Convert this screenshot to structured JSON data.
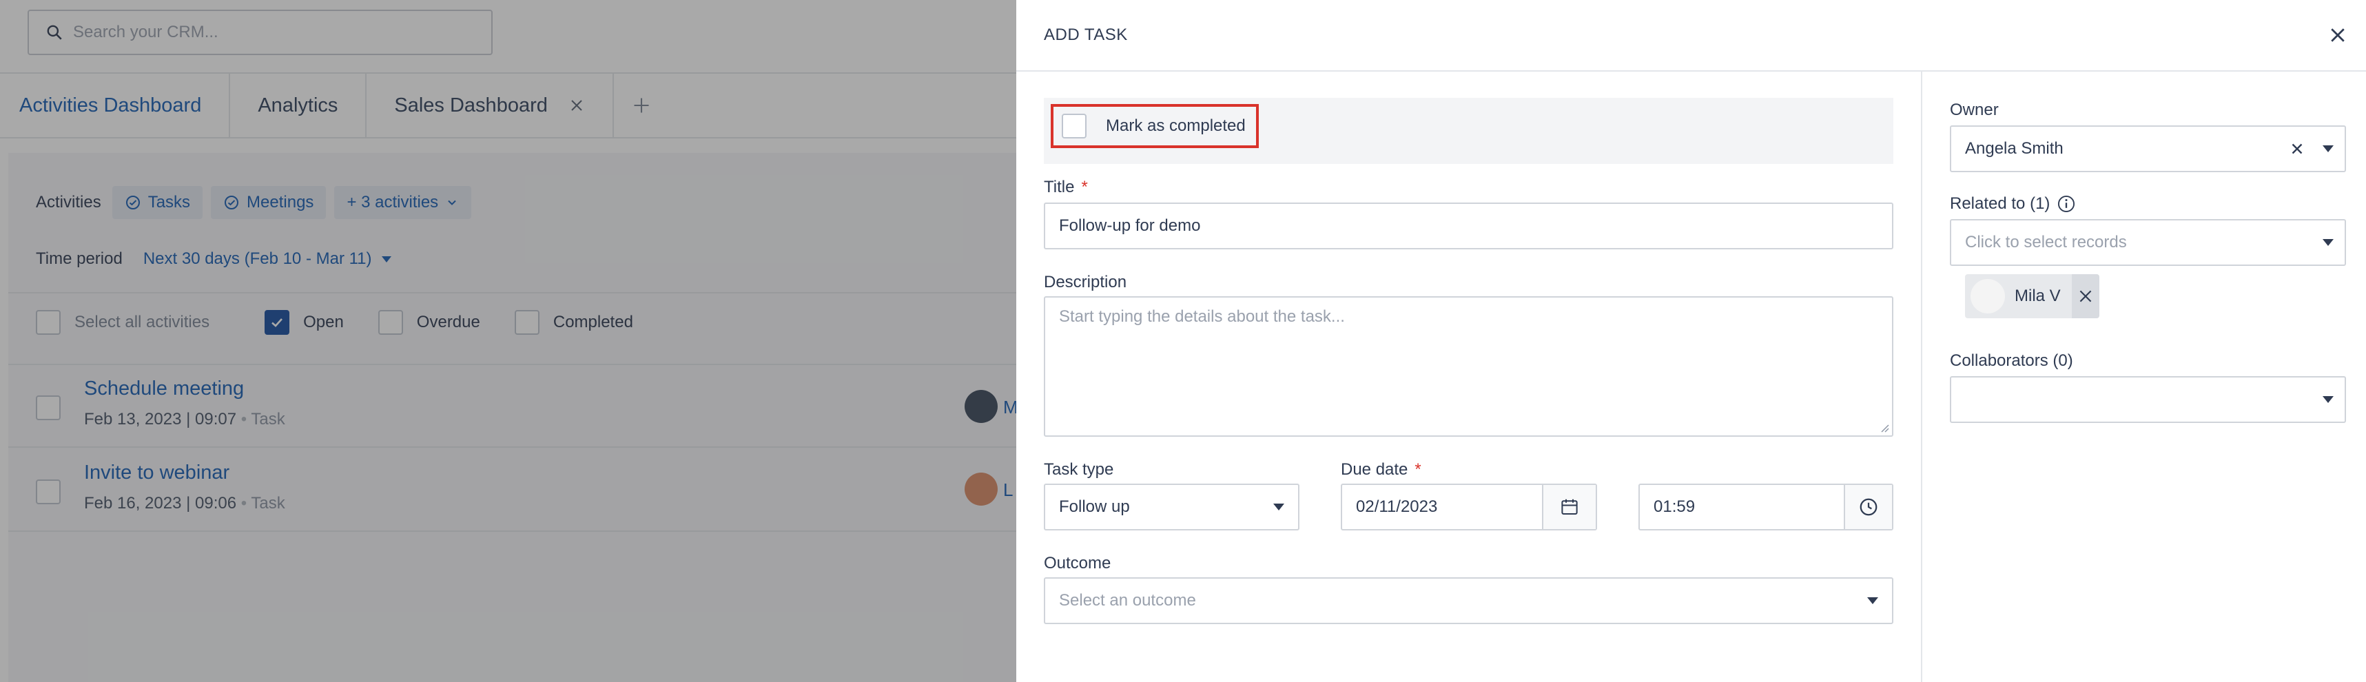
{
  "search": {
    "placeholder": "Search your CRM..."
  },
  "tabs": [
    {
      "label": "Activities Dashboard"
    },
    {
      "label": "Analytics"
    },
    {
      "label": "Sales Dashboard"
    }
  ],
  "activities_filter": {
    "label": "Activities",
    "chips": [
      "Tasks",
      "Meetings",
      "+ 3 activities"
    ]
  },
  "time_period": {
    "label": "Time period",
    "value": "Next 30 days (Feb 10 - Mar 11)"
  },
  "status_filter": {
    "select_all": "Select all activities",
    "open": "Open",
    "overdue": "Overdue",
    "completed": "Completed"
  },
  "activity_list": [
    {
      "title": "Schedule meeting",
      "date": "Feb 13, 2023 | 09:07",
      "type": "Task",
      "owner_initial": "M"
    },
    {
      "title": "Invite to webinar",
      "date": "Feb 16, 2023 | 09:06",
      "type": "Task",
      "owner_initial": "L"
    }
  ],
  "modal": {
    "title": "ADD TASK",
    "mark_completed": "Mark as completed",
    "title_label": "Title",
    "title_value": "Follow-up for demo",
    "description_label": "Description",
    "description_placeholder": "Start typing the details about the task...",
    "task_type_label": "Task type",
    "task_type_value": "Follow up",
    "due_date_label": "Due date",
    "due_date_value": "02/11/2023",
    "due_time_value": "01:59",
    "outcome_label": "Outcome",
    "outcome_placeholder": "Select an outcome",
    "required_marker": "*",
    "owner_label": "Owner",
    "owner_value": "Angela Smith",
    "related_label": "Related to (1)",
    "related_placeholder": "Click to select records",
    "related_records": [
      "Mila V"
    ],
    "collaborators_label": "Collaborators (0)"
  },
  "colors": {
    "accent": "#1a5fb4",
    "highlight": "#d9332b",
    "overlay": "rgba(40,40,40,0.40)"
  }
}
